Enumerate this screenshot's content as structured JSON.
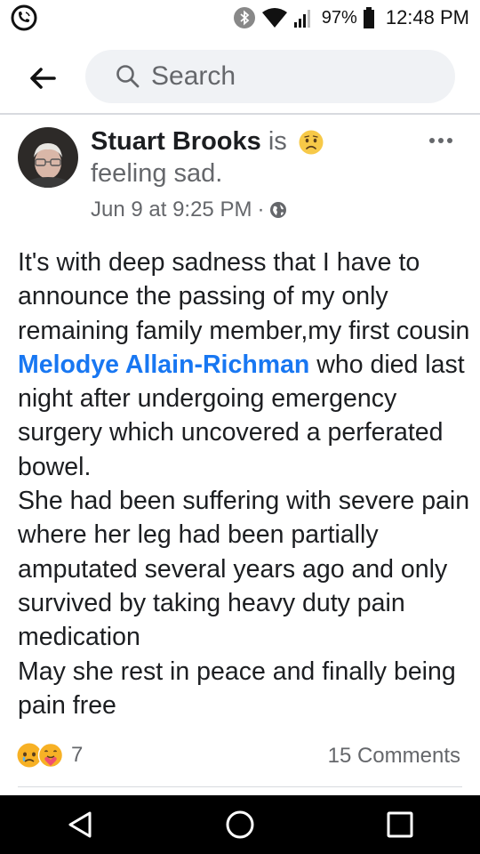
{
  "status_bar": {
    "battery": "97%",
    "time": "12:48 PM"
  },
  "search": {
    "placeholder": "Search"
  },
  "post": {
    "author": "Stuart Brooks",
    "verb": "is",
    "feeling": "feeling sad.",
    "date": "Jun 9 at 9:25 PM",
    "separator": "·",
    "body_intro": "It's with deep sadness that I have to announce the passing of my only remaining family member,my first cousin",
    "tagged_person": "Melodye Allain-Richman",
    "body_after_tag": "who died last night after undergoing emergency surgery which uncovered a perferated bowel.",
    "body_line2": "She had been suffering with severe pain where her leg had been partially amputated several years ago and only survived by taking heavy duty pain medication",
    "body_line3": "May she rest in peace and finally being pain free",
    "reaction_count": "7",
    "comments": "15 Comments"
  },
  "icons": {
    "status_left": "phone-notification-icon",
    "bluetooth": "bluetooth-icon",
    "wifi": "wifi-icon",
    "signal": "signal-icon",
    "battery": "battery-icon",
    "back": "back-arrow-icon",
    "search": "search-icon",
    "globe": "globe-icon",
    "more": "more-options-icon",
    "feeling": "sad-face-icon",
    "reactions": [
      "sad-reaction-icon",
      "care-reaction-icon"
    ],
    "nav": [
      "back-triangle-icon",
      "home-circle-icon",
      "recents-square-icon"
    ]
  },
  "colors": {
    "link": "#1877f2",
    "secondary_text": "#65676b",
    "search_bg": "#f0f2f5"
  }
}
